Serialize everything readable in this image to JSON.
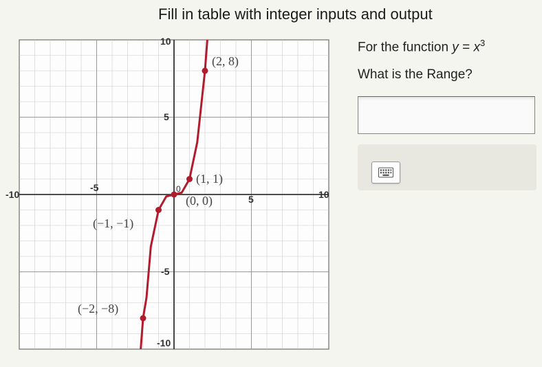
{
  "title": "Fill in table with integer inputs and output",
  "right": {
    "func_prefix": "For the function ",
    "func_y": "y",
    "func_eq": " = ",
    "func_x": "x",
    "func_exp": "3",
    "question": "What is the Range?",
    "answer_value": ""
  },
  "chart_data": {
    "type": "line",
    "title": "",
    "xlabel": "",
    "ylabel": "",
    "xlim": [
      -10,
      10
    ],
    "ylim": [
      -10,
      10
    ],
    "x_ticks": [
      -10,
      -5,
      0,
      5,
      10
    ],
    "y_ticks": [
      -10,
      -5,
      5,
      10
    ],
    "grid": true,
    "series": [
      {
        "name": "y = x^3",
        "color": "#b01c2e",
        "x": [
          -2.15,
          -2,
          -1.5,
          -1,
          -0.5,
          0,
          0.5,
          1,
          1.5,
          2,
          2.15
        ],
        "y": [
          -10,
          -8,
          -3.375,
          -1,
          -0.125,
          0,
          0.125,
          1,
          3.375,
          8,
          10
        ]
      }
    ],
    "labeled_points": [
      {
        "x": 2,
        "y": 8,
        "label": "(2, 8)"
      },
      {
        "x": 1,
        "y": 1,
        "label": "(1, 1)"
      },
      {
        "x": 0,
        "y": 0,
        "label": "(0, 0)"
      },
      {
        "x": -1,
        "y": -1,
        "label": "(-1, -1)"
      },
      {
        "x": -2,
        "y": -8,
        "label": "(-2, -8)"
      }
    ],
    "axis_labels": {
      "x": {
        "neg10": "-10",
        "neg5": "-5",
        "origin": "0",
        "pos5": "5",
        "pos10": "10"
      },
      "y": {
        "neg10": "-10",
        "neg5": "-5",
        "pos5": "5",
        "pos10": "10"
      }
    },
    "point_text": {
      "p28": "(2, 8)",
      "p11": "(1, 1)",
      "p00": "(0, 0)",
      "pn1n1": "(−1, −1)",
      "pn2n8": "(−2, −8)"
    }
  }
}
